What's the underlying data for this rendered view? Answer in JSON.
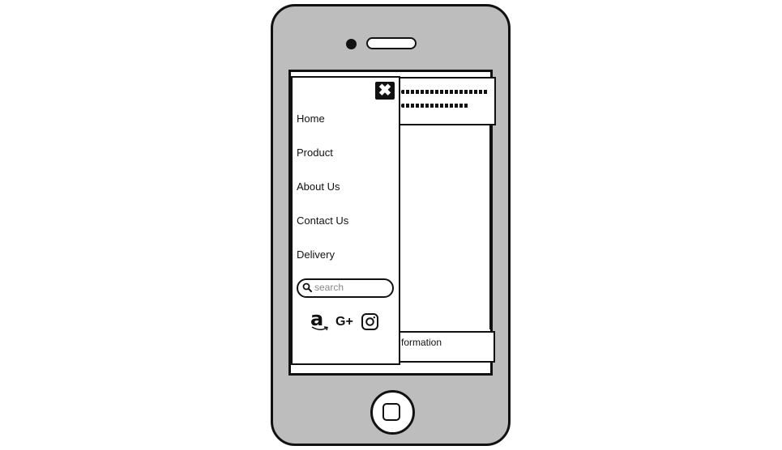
{
  "menu": {
    "close_label": "✖",
    "items": [
      {
        "label": "Home"
      },
      {
        "label": "Product"
      },
      {
        "label": "About Us"
      },
      {
        "label": "Contact Us"
      },
      {
        "label": "Delivery"
      }
    ],
    "search_placeholder": "search",
    "social": {
      "amazon_glyph": "a",
      "gplus_glyph": "G+",
      "icons": [
        "amazon-icon",
        "google-plus-icon",
        "instagram-icon"
      ]
    }
  },
  "page": {
    "footer_text": "formation"
  },
  "colors": {
    "phone_body": "#bdbdbd",
    "outline": "#111111",
    "screen": "#ffffff",
    "placeholder": "#888888"
  }
}
